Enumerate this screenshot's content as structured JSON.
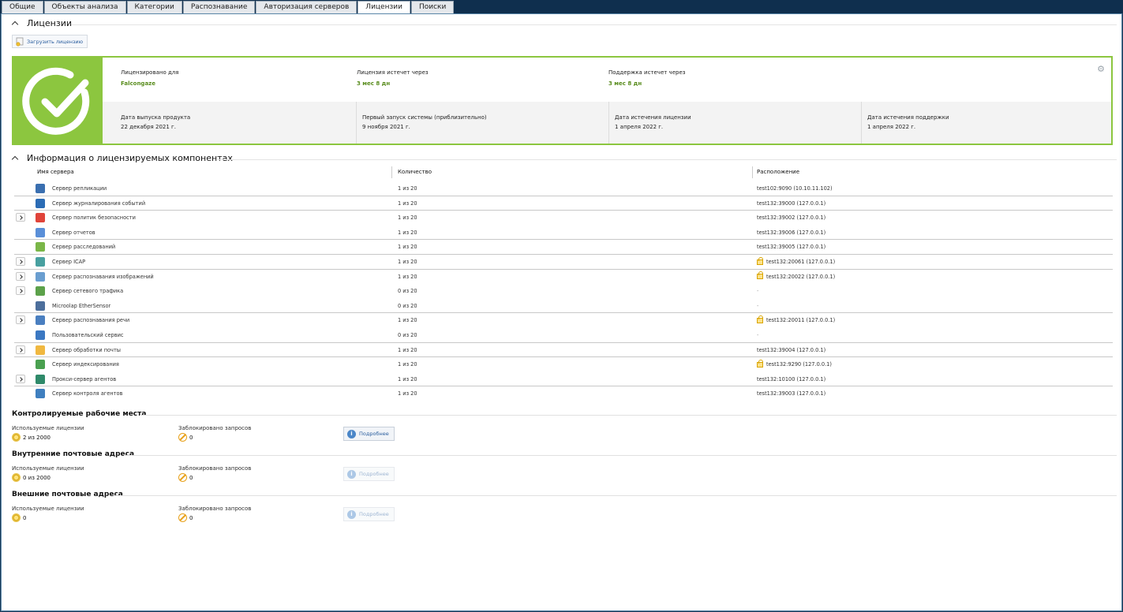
{
  "tabs": [
    "Общие",
    "Объекты анализа",
    "Категории",
    "Распознавание",
    "Авторизация серверов",
    "Лицензии",
    "Поиски"
  ],
  "active_tab": "Лицензии",
  "licenses_section": {
    "title": "Лицензии",
    "upload_button": "Загрузить лицензию"
  },
  "license_card": {
    "licensed_for_label": "Лицензировано для",
    "licensed_for": "Falcongaze",
    "license_expires_label": "Лицензия истечет через",
    "license_expires": "3 мес 8 дн",
    "support_expires_label": "Поддержка истечет через",
    "support_expires": "3 мес 8 дн",
    "release_date_label": "Дата выпуска продукта",
    "release_date": "22 декабря 2021 г.",
    "first_launch_label": "Первый запуск системы (приблизительно)",
    "first_launch": "9 ноября 2021 г.",
    "license_end_label": "Дата истечения лицензии",
    "license_end": "1 апреля 2022 г.",
    "support_end_label": "Дата истечения поддержки",
    "support_end": "1 апреля 2022 г.",
    "accent_color": "#8cc63f"
  },
  "components": {
    "title": "Информация о лицензируемых компонентах",
    "headers": {
      "name": "Имя сервера",
      "quantity": "Количество",
      "location": "Расположение"
    },
    "rows": [
      {
        "name": "Сервер репликации",
        "quantity": "1 из 20",
        "location": "test102:9090 (10.10.11.102)",
        "icon": "replication-icon",
        "color": "#3a6fb0",
        "expand": false,
        "lock": false,
        "sep": true
      },
      {
        "name": "Сервер журналирования событий",
        "quantity": "1 из 20",
        "location": "test132:39000 (127.0.0.1)",
        "icon": "event-log-icon",
        "color": "#2b6cb5",
        "expand": false,
        "lock": false,
        "sep": true
      },
      {
        "name": "Сервер политик безопасности",
        "quantity": "1 из 20",
        "location": "test132:39002 (127.0.0.1)",
        "icon": "alarm-icon",
        "color": "#e0443a",
        "expand": true,
        "lock": false,
        "sep": false
      },
      {
        "name": "Сервер отчетов",
        "quantity": "1 из 20",
        "location": "test132:39006 (127.0.0.1)",
        "icon": "report-icon",
        "color": "#5a8fd8",
        "expand": false,
        "lock": false,
        "sep": true
      },
      {
        "name": "Сервер расследований",
        "quantity": "1 из 20",
        "location": "test132:39005 (127.0.0.1)",
        "icon": "investigation-icon",
        "color": "#7ab648",
        "expand": false,
        "lock": false,
        "sep": true
      },
      {
        "name": "Сервер ICAP",
        "quantity": "1 из 20",
        "location": "test132:20061 (127.0.0.1)",
        "icon": "icap-icon",
        "color": "#48a0a0",
        "expand": true,
        "lock": true,
        "sep": true
      },
      {
        "name": "Сервер распознавания изображений",
        "quantity": "1 из 20",
        "location": "test132:20022 (127.0.0.1)",
        "icon": "image-recognition-icon",
        "color": "#6a9ed0",
        "expand": true,
        "lock": true,
        "sep": false
      },
      {
        "name": "Сервер сетевого трафика",
        "quantity": "0 из 20",
        "location": "-",
        "icon": "network-traffic-icon",
        "color": "#5ca14a",
        "expand": true,
        "lock": false,
        "sep": false
      },
      {
        "name": "Microolap EtherSensor",
        "quantity": "0 из 20",
        "location": "-",
        "icon": "ethersensor-icon",
        "color": "#4d6f9c",
        "expand": false,
        "lock": false,
        "sep": true
      },
      {
        "name": "Сервер распознавания речи",
        "quantity": "1 из 20",
        "location": "test132:20011 (127.0.0.1)",
        "icon": "speech-recognition-icon",
        "color": "#4a7fc0",
        "expand": true,
        "lock": true,
        "sep": false
      },
      {
        "name": "Пользовательский сервис",
        "quantity": "0 из 20",
        "location": "-",
        "icon": "custom-service-icon",
        "color": "#3b78c2",
        "expand": false,
        "lock": false,
        "sep": true
      },
      {
        "name": "Сервер обработки почты",
        "quantity": "1 из 20",
        "location": "test132:39004 (127.0.0.1)",
        "icon": "mail-icon",
        "color": "#f0b840",
        "expand": true,
        "lock": false,
        "sep": true
      },
      {
        "name": "Сервер индексирования",
        "quantity": "1 из 20",
        "location": "test132:9290 (127.0.0.1)",
        "icon": "indexing-icon",
        "color": "#4aa050",
        "expand": false,
        "lock": true,
        "sep": false
      },
      {
        "name": "Прокси-сервер агентов",
        "quantity": "1 из 20",
        "location": "test132:10100 (127.0.0.1)",
        "icon": "agent-proxy-icon",
        "color": "#2f8a6a",
        "expand": true,
        "lock": false,
        "sep": true
      },
      {
        "name": "Сервер контроля агентов",
        "quantity": "1 из 20",
        "location": "test132:39003 (127.0.0.1)",
        "icon": "agent-control-icon",
        "color": "#3f7fbf",
        "expand": false,
        "lock": false,
        "sep": false
      }
    ]
  },
  "groups": [
    {
      "title": "Контролируемые рабочие места",
      "used_label": "Используемые лицензии",
      "used": "2 из 2000",
      "blocked_label": "Заблокировано запросов",
      "blocked": "0",
      "more": "Подробнее",
      "more_enabled": true
    },
    {
      "title": "Внутренние почтовые адреса",
      "used_label": "Используемые лицензии",
      "used": "0 из 2000",
      "blocked_label": "Заблокировано запросов",
      "blocked": "0",
      "more": "Подробнее",
      "more_enabled": false
    },
    {
      "title": "Внешние почтовые адреса",
      "used_label": "Используемые лицензии",
      "used": "0",
      "blocked_label": "Заблокировано запросов",
      "blocked": "0",
      "more": "Подробнее",
      "more_enabled": false
    }
  ]
}
